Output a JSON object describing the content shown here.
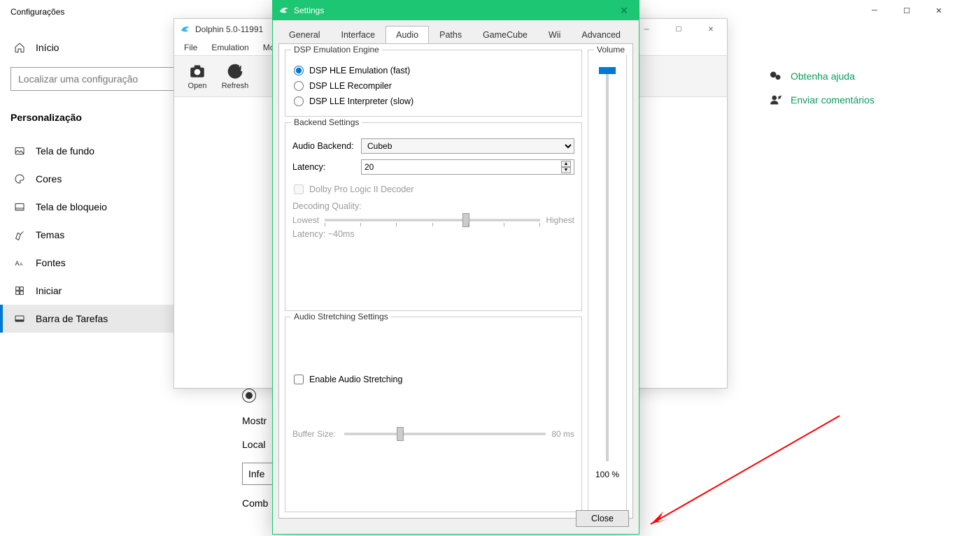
{
  "windows_settings": {
    "title": "Configurações",
    "home": "Início",
    "search_placeholder": "Localizar uma configuração",
    "section": "Personalização",
    "items": [
      {
        "label": "Tela de fundo"
      },
      {
        "label": "Cores"
      },
      {
        "label": "Tela de bloqueio"
      },
      {
        "label": "Temas"
      },
      {
        "label": "Fontes"
      },
      {
        "label": "Iniciar"
      },
      {
        "label": "Barra de Tarefas"
      }
    ],
    "help": {
      "a": "Obtenha ajuda",
      "b": "Enviar comentários"
    },
    "main": {
      "mostr": "Mostr",
      "local": "Local",
      "infe": "Infe",
      "comb": "Comb"
    }
  },
  "dolphin": {
    "title": "Dolphin 5.0-11991",
    "menu": [
      "File",
      "Emulation",
      "Mo"
    ],
    "toolbar": {
      "open": "Open",
      "refresh": "Refresh"
    }
  },
  "dialog": {
    "title": "Settings",
    "tabs": [
      "General",
      "Interface",
      "Audio",
      "Paths",
      "GameCube",
      "Wii",
      "Advanced"
    ],
    "active_tab": 2,
    "dsp": {
      "legend": "DSP Emulation Engine",
      "opt1": "DSP HLE Emulation (fast)",
      "opt2": "DSP LLE Recompiler",
      "opt3": "DSP LLE Interpreter (slow)",
      "selected": 0
    },
    "backend": {
      "legend": "Backend Settings",
      "audio_backend_label": "Audio Backend:",
      "audio_backend_value": "Cubeb",
      "latency_label": "Latency:",
      "latency_value": "20",
      "dolby": "Dolby Pro Logic II Decoder",
      "decoding_quality": "Decoding Quality:",
      "lowest": "Lowest",
      "highest": "Highest",
      "latency_est": "Latency:  ~40ms"
    },
    "stretch": {
      "legend": "Audio Stretching Settings",
      "enable": "Enable Audio Stretching",
      "buffer_label": "Buffer Size:",
      "buffer_value": "80 ms"
    },
    "volume": {
      "legend": "Volume",
      "value": "100 %",
      "percent": 100
    },
    "close": "Close"
  }
}
